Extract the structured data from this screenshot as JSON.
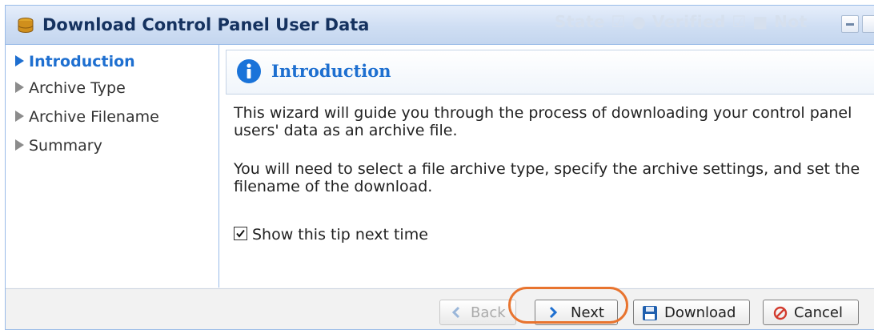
{
  "window": {
    "title": "Download Control Panel User Data",
    "background_hint": "State ☑ ● Verified ☑ ■ Not"
  },
  "nav": {
    "items": [
      {
        "label": "Introduction",
        "active": true
      },
      {
        "label": "Archive Type",
        "active": false
      },
      {
        "label": "Archive Filename",
        "active": false
      },
      {
        "label": "Summary",
        "active": false
      }
    ]
  },
  "content": {
    "title": "Introduction",
    "para1": "This wizard will guide you through the process of downloading your control panel users' data as an archive file.",
    "para2": "You will need to select a file archive type, specify the archive settings, and set the filename of the download.",
    "show_tip_label": "Show this tip next time",
    "show_tip_checked": true
  },
  "footer": {
    "back_label": "Back",
    "next_label": "Next",
    "download_label": "Download",
    "cancel_label": "Cancel"
  },
  "colors": {
    "accent": "#1e6fd0",
    "highlight": "#e8742f",
    "titlebar": "#cfdef3"
  }
}
